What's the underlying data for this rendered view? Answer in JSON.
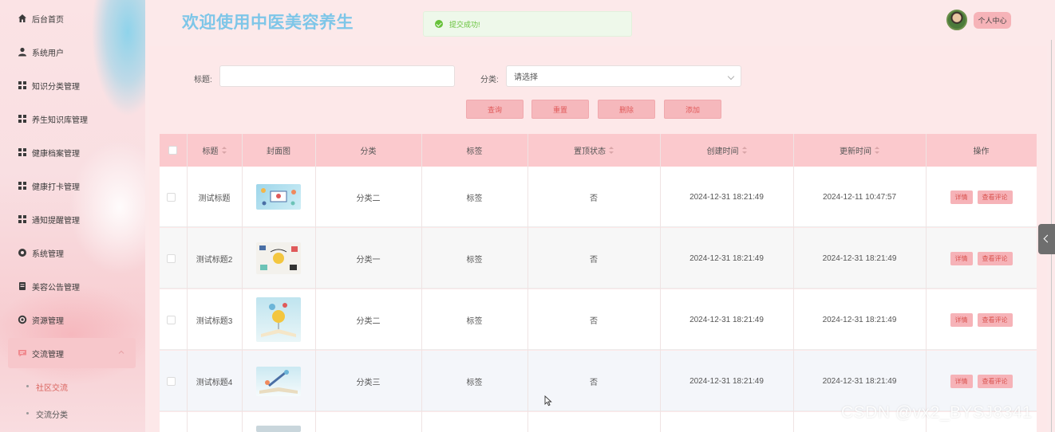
{
  "sidebar": {
    "items": [
      {
        "label": "后台首页",
        "icon": "home-icon"
      },
      {
        "label": "系统用户",
        "icon": "user-icon"
      },
      {
        "label": "知识分类管理",
        "icon": "grid-icon"
      },
      {
        "label": "养生知识库管理",
        "icon": "grid-icon"
      },
      {
        "label": "健康档案管理",
        "icon": "grid-icon"
      },
      {
        "label": "健康打卡管理",
        "icon": "grid-icon"
      },
      {
        "label": "通知提醒管理",
        "icon": "grid-icon"
      },
      {
        "label": "系统管理",
        "icon": "gear-icon"
      },
      {
        "label": "美容公告管理",
        "icon": "document-icon"
      },
      {
        "label": "资源管理",
        "icon": "plus-circle-icon"
      },
      {
        "label": "交流管理",
        "icon": "chat-icon"
      }
    ],
    "sub_items": [
      {
        "label": "社区交流"
      },
      {
        "label": "交流分类"
      }
    ]
  },
  "header": {
    "title": "欢迎使用中医美容养生",
    "toast": "提交成功!",
    "profile_label": "个人中心"
  },
  "search": {
    "title_label": "标题:",
    "title_value": "",
    "category_label": "分类:",
    "category_placeholder": "请选择"
  },
  "actions": {
    "query": "查询",
    "reset": "重置",
    "delete": "删除",
    "add": "添加"
  },
  "table": {
    "headers": {
      "title": "标题",
      "cover": "封面图",
      "category": "分类",
      "tags": "标签",
      "pinned": "置顶状态",
      "created": "创建时间",
      "updated": "更新时间",
      "actions": "操作"
    },
    "rows": [
      {
        "title": "测试标题",
        "category": "分类二",
        "tags": "标签",
        "pinned": "否",
        "created": "2024-12-31 18:21:49",
        "updated": "2024-12-11 10:47:57"
      },
      {
        "title": "测试标题2",
        "category": "分类一",
        "tags": "标签",
        "pinned": "否",
        "created": "2024-12-31 18:21:49",
        "updated": "2024-12-31 18:21:49"
      },
      {
        "title": "测试标题3",
        "category": "分类二",
        "tags": "标签",
        "pinned": "否",
        "created": "2024-12-31 18:21:49",
        "updated": "2024-12-31 18:21:49"
      },
      {
        "title": "测试标题4",
        "category": "分类三",
        "tags": "标签",
        "pinned": "否",
        "created": "2024-12-31 18:21:49",
        "updated": "2024-12-31 18:21:49"
      }
    ],
    "detail_label": "详情",
    "comments_label": "查看评论"
  },
  "watermark": "CSDN @vx2_BYSJ8341",
  "colors": {
    "title_blue": "#7ec6e8",
    "header_row": "#fbc9cd",
    "button_pink": "#f6b8bc",
    "button_text": "#e05a5a",
    "toast_green": "#67c23a"
  }
}
